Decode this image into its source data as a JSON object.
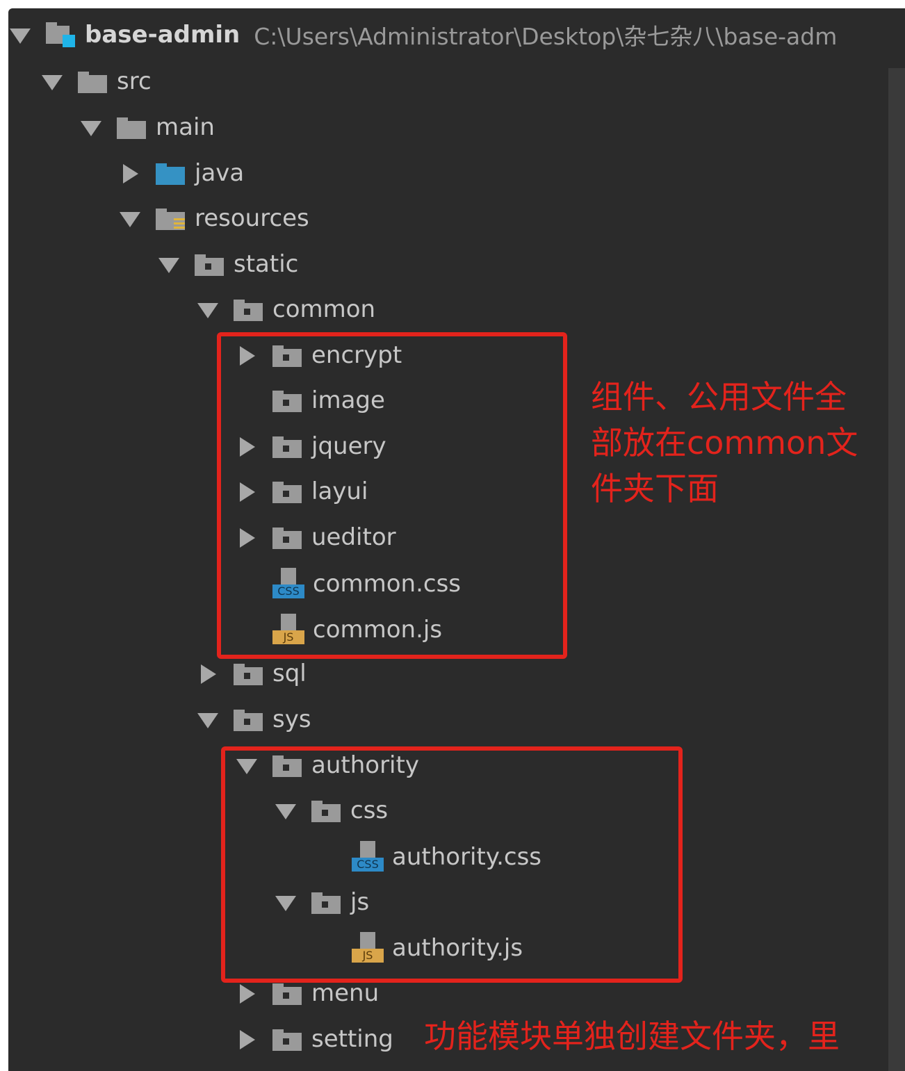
{
  "root": {
    "name": "base-admin",
    "path": "C:\\Users\\Administrator\\Desktop\\杂七杂八\\base-adm"
  },
  "tree": [
    {
      "label": "src",
      "state": "open",
      "icon": "folder-gray"
    },
    {
      "label": "main",
      "state": "open",
      "icon": "folder-gray"
    },
    {
      "label": "java",
      "state": "closed",
      "icon": "folder-blue"
    },
    {
      "label": "resources",
      "state": "open",
      "icon": "folder-resources"
    },
    {
      "label": "static",
      "state": "open",
      "icon": "folder-package"
    },
    {
      "label": "common",
      "state": "open",
      "icon": "folder-package"
    },
    {
      "label": "encrypt",
      "state": "closed",
      "icon": "folder-package"
    },
    {
      "label": "image",
      "state": "none",
      "icon": "folder-package"
    },
    {
      "label": "jquery",
      "state": "closed",
      "icon": "folder-package"
    },
    {
      "label": "layui",
      "state": "closed",
      "icon": "folder-package"
    },
    {
      "label": "ueditor",
      "state": "closed",
      "icon": "folder-package"
    },
    {
      "label": "common.css",
      "state": "none",
      "icon": "css-file",
      "badge": "CSS"
    },
    {
      "label": "common.js",
      "state": "none",
      "icon": "js-file",
      "badge": "JS"
    },
    {
      "label": "sql",
      "state": "closed",
      "icon": "folder-package"
    },
    {
      "label": "sys",
      "state": "open",
      "icon": "folder-package"
    },
    {
      "label": "authority",
      "state": "open",
      "icon": "folder-package"
    },
    {
      "label": "css",
      "state": "open",
      "icon": "folder-package"
    },
    {
      "label": "authority.css",
      "state": "none",
      "icon": "css-file",
      "badge": "CSS"
    },
    {
      "label": "js",
      "state": "open",
      "icon": "folder-package"
    },
    {
      "label": "authority.js",
      "state": "none",
      "icon": "js-file",
      "badge": "JS"
    },
    {
      "label": "menu",
      "state": "closed",
      "icon": "folder-package"
    },
    {
      "label": "setting",
      "state": "closed",
      "icon": "folder-package"
    }
  ],
  "annotations": {
    "note1": "组件、公用文件全部放在common文件夹下面",
    "note1_lines": [
      "组件、公用文件全",
      "部放在common文",
      "件夹下面"
    ],
    "note2": "功能模块单独创建文件夹，里"
  },
  "colors": {
    "background": "#2b2b2b",
    "text": "#c7c7c7",
    "annotation": "#e3231c",
    "css_badge": "#2d8ac7",
    "js_badge": "#d9a54a"
  }
}
